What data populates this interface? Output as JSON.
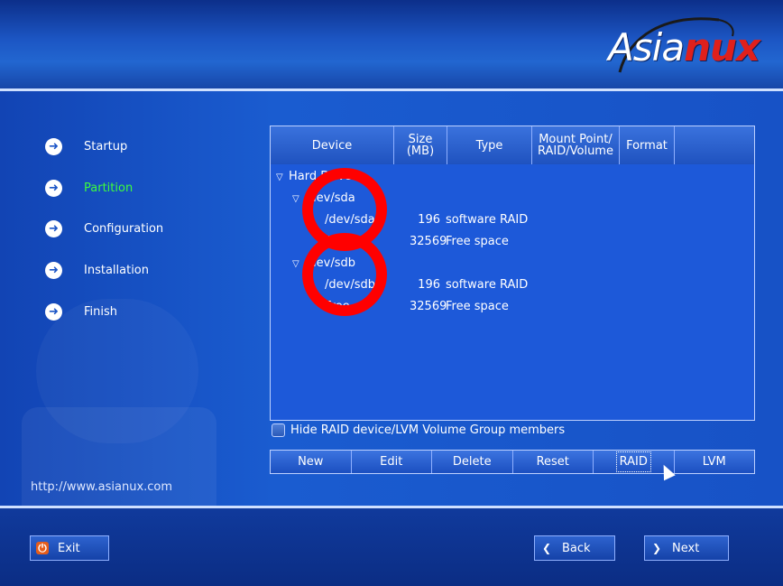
{
  "brand": {
    "logo_text_a": "Asia",
    "logo_text_b": "nux"
  },
  "steps": [
    {
      "label": "Startup",
      "state": "done"
    },
    {
      "label": "Partition",
      "state": "active"
    },
    {
      "label": "Configuration",
      "state": "pending"
    },
    {
      "label": "Installation",
      "state": "pending"
    },
    {
      "label": "Finish",
      "state": "pending"
    }
  ],
  "site_url": "http://www.asianux.com",
  "table": {
    "columns": [
      {
        "label": "Device"
      },
      {
        "label": "Size\n(MB)"
      },
      {
        "label": "Type"
      },
      {
        "label": "Mount Point/\nRAID/Volume"
      },
      {
        "label": "Format"
      }
    ],
    "rows": [
      {
        "indent": 0,
        "expander": "▽",
        "device": "Hard Drives",
        "size": "",
        "type": ""
      },
      {
        "indent": 1,
        "expander": "▽",
        "device": "/dev/sda",
        "size": "",
        "type": ""
      },
      {
        "indent": 2,
        "expander": "",
        "device": "/dev/sda1",
        "size": "196",
        "type": "software RAID"
      },
      {
        "indent": 2,
        "expander": "",
        "device": "Free",
        "size": "32569",
        "type": "Free space"
      },
      {
        "indent": 1,
        "expander": "▽",
        "device": "/dev/sdb",
        "size": "",
        "type": ""
      },
      {
        "indent": 2,
        "expander": "",
        "device": "/dev/sdb1",
        "size": "196",
        "type": "software RAID"
      },
      {
        "indent": 2,
        "expander": "",
        "device": "Free",
        "size": "32569",
        "type": "Free space"
      }
    ]
  },
  "hide_members": {
    "label": "Hide RAID device/LVM Volume Group members",
    "checked": false
  },
  "actions": {
    "new": "New",
    "edit": "Edit",
    "delete": "Delete",
    "reset": "Reset",
    "raid": "RAID",
    "lvm": "LVM"
  },
  "nav": {
    "exit": "Exit",
    "back": "Back",
    "next": "Next"
  },
  "colors": {
    "accent_green": "#3dfc3d",
    "annotation_red": "#ff0000",
    "panel_blue": "#1d59d9"
  }
}
